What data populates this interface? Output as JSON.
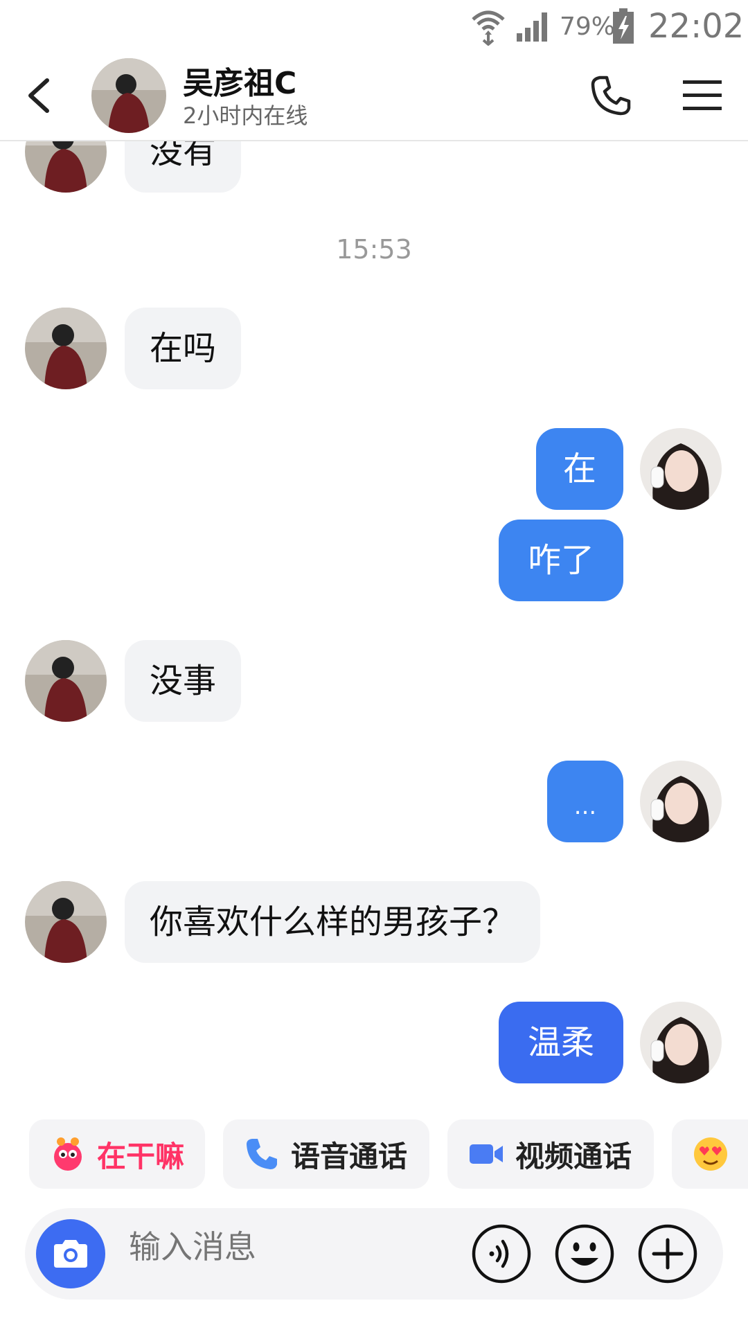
{
  "status_bar": {
    "battery_percent": "79%",
    "time": "22:02"
  },
  "header": {
    "contact_name": "吴彦祖C",
    "status": "2小时内在线"
  },
  "messages": [
    {
      "from": "contact",
      "text": "没有"
    },
    {
      "from": "timestamp",
      "text": "15:53"
    },
    {
      "from": "contact",
      "text": "在吗"
    },
    {
      "from": "me",
      "text": "在"
    },
    {
      "from": "me",
      "text": "咋了"
    },
    {
      "from": "contact",
      "text": "没事"
    },
    {
      "from": "me",
      "text": "..."
    },
    {
      "from": "contact",
      "text": "你喜欢什么样的男孩子？"
    },
    {
      "from": "me",
      "text": "温柔"
    }
  ],
  "quick_actions": [
    {
      "label": "在干嘛",
      "icon": "ghost-icon",
      "color": "#ff3366"
    },
    {
      "label": "语音通话",
      "icon": "phone-icon",
      "color": "#222222"
    },
    {
      "label": "视频通话",
      "icon": "video-camera-icon",
      "color": "#222222"
    },
    {
      "label": "",
      "icon": "heart-eyes-emoji-icon",
      "color": "#222222"
    }
  ],
  "input": {
    "placeholder": "输入消息"
  },
  "colors": {
    "accent": "#3d85f1",
    "incoming_bubble": "#f2f3f5",
    "quick_action_highlight": "#ff3366"
  }
}
